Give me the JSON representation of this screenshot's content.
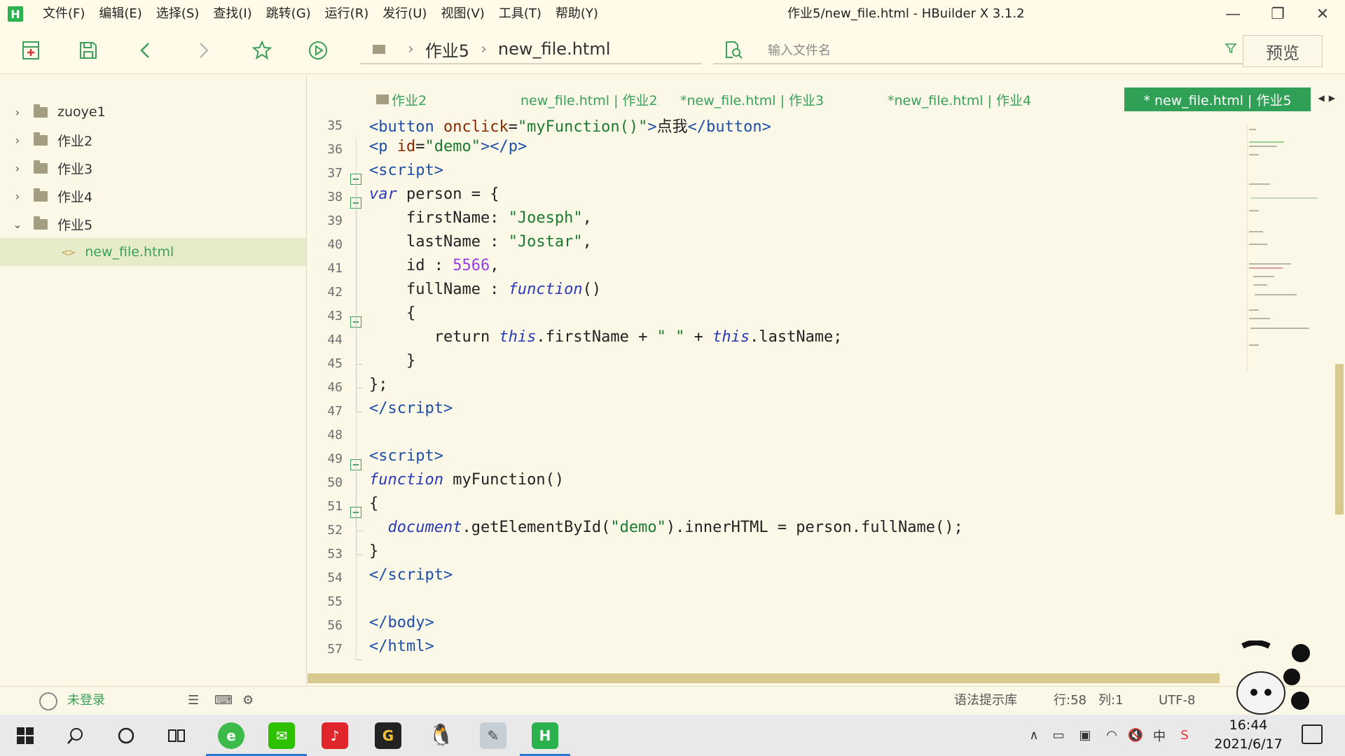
{
  "window": {
    "title": "作业5/new_file.html - HBuilder X 3.1.2",
    "logo_letter": "H",
    "minimize": "—",
    "maximize": "❐",
    "close": "✕"
  },
  "menu": [
    "文件(F)",
    "编辑(E)",
    "选择(S)",
    "查找(I)",
    "跳转(G)",
    "运行(R)",
    "发行(U)",
    "视图(V)",
    "工具(T)",
    "帮助(Y)"
  ],
  "toolbar": {
    "breadcrumb": [
      "作业5",
      "new_file.html"
    ],
    "search_placeholder": "输入文件名",
    "preview_label": "预览"
  },
  "sidebar": {
    "items": [
      {
        "label": "zuoye1",
        "expanded": false
      },
      {
        "label": "作业2",
        "expanded": false
      },
      {
        "label": "作业3",
        "expanded": false
      },
      {
        "label": "作业4",
        "expanded": false
      },
      {
        "label": "作业5",
        "expanded": true
      }
    ],
    "file": "new_file.html"
  },
  "tabs": [
    {
      "label": "作业2"
    },
    {
      "label": "new_file.html | 作业2"
    },
    {
      "label": "*new_file.html | 作业3"
    },
    {
      "label": "*new_file.html | 作业4"
    },
    {
      "label": "* new_file.html | 作业5",
      "active": true
    }
  ],
  "editor": {
    "line_numbers": [
      "35",
      "36",
      "37",
      "38",
      "39",
      "40",
      "41",
      "42",
      "43",
      "44",
      "45",
      "46",
      "47",
      "48",
      "49",
      "50",
      "51",
      "52",
      "53",
      "54",
      "55",
      "56",
      "57"
    ]
  },
  "statusbar": {
    "login": "未登录",
    "syntax_lib": "语法提示库",
    "row": "行:58",
    "col": "列:1",
    "encoding": "UTF-8"
  },
  "taskbar": {
    "time": "16:44",
    "date": "2021/6/17",
    "ime": "中"
  },
  "colors": {
    "accent": "#2fa055",
    "background": "#fbf8e8",
    "tag": "#1e4fa6",
    "string": "#1b7a2f",
    "keyword": "#2b3ab8",
    "number": "#9a3de0"
  }
}
